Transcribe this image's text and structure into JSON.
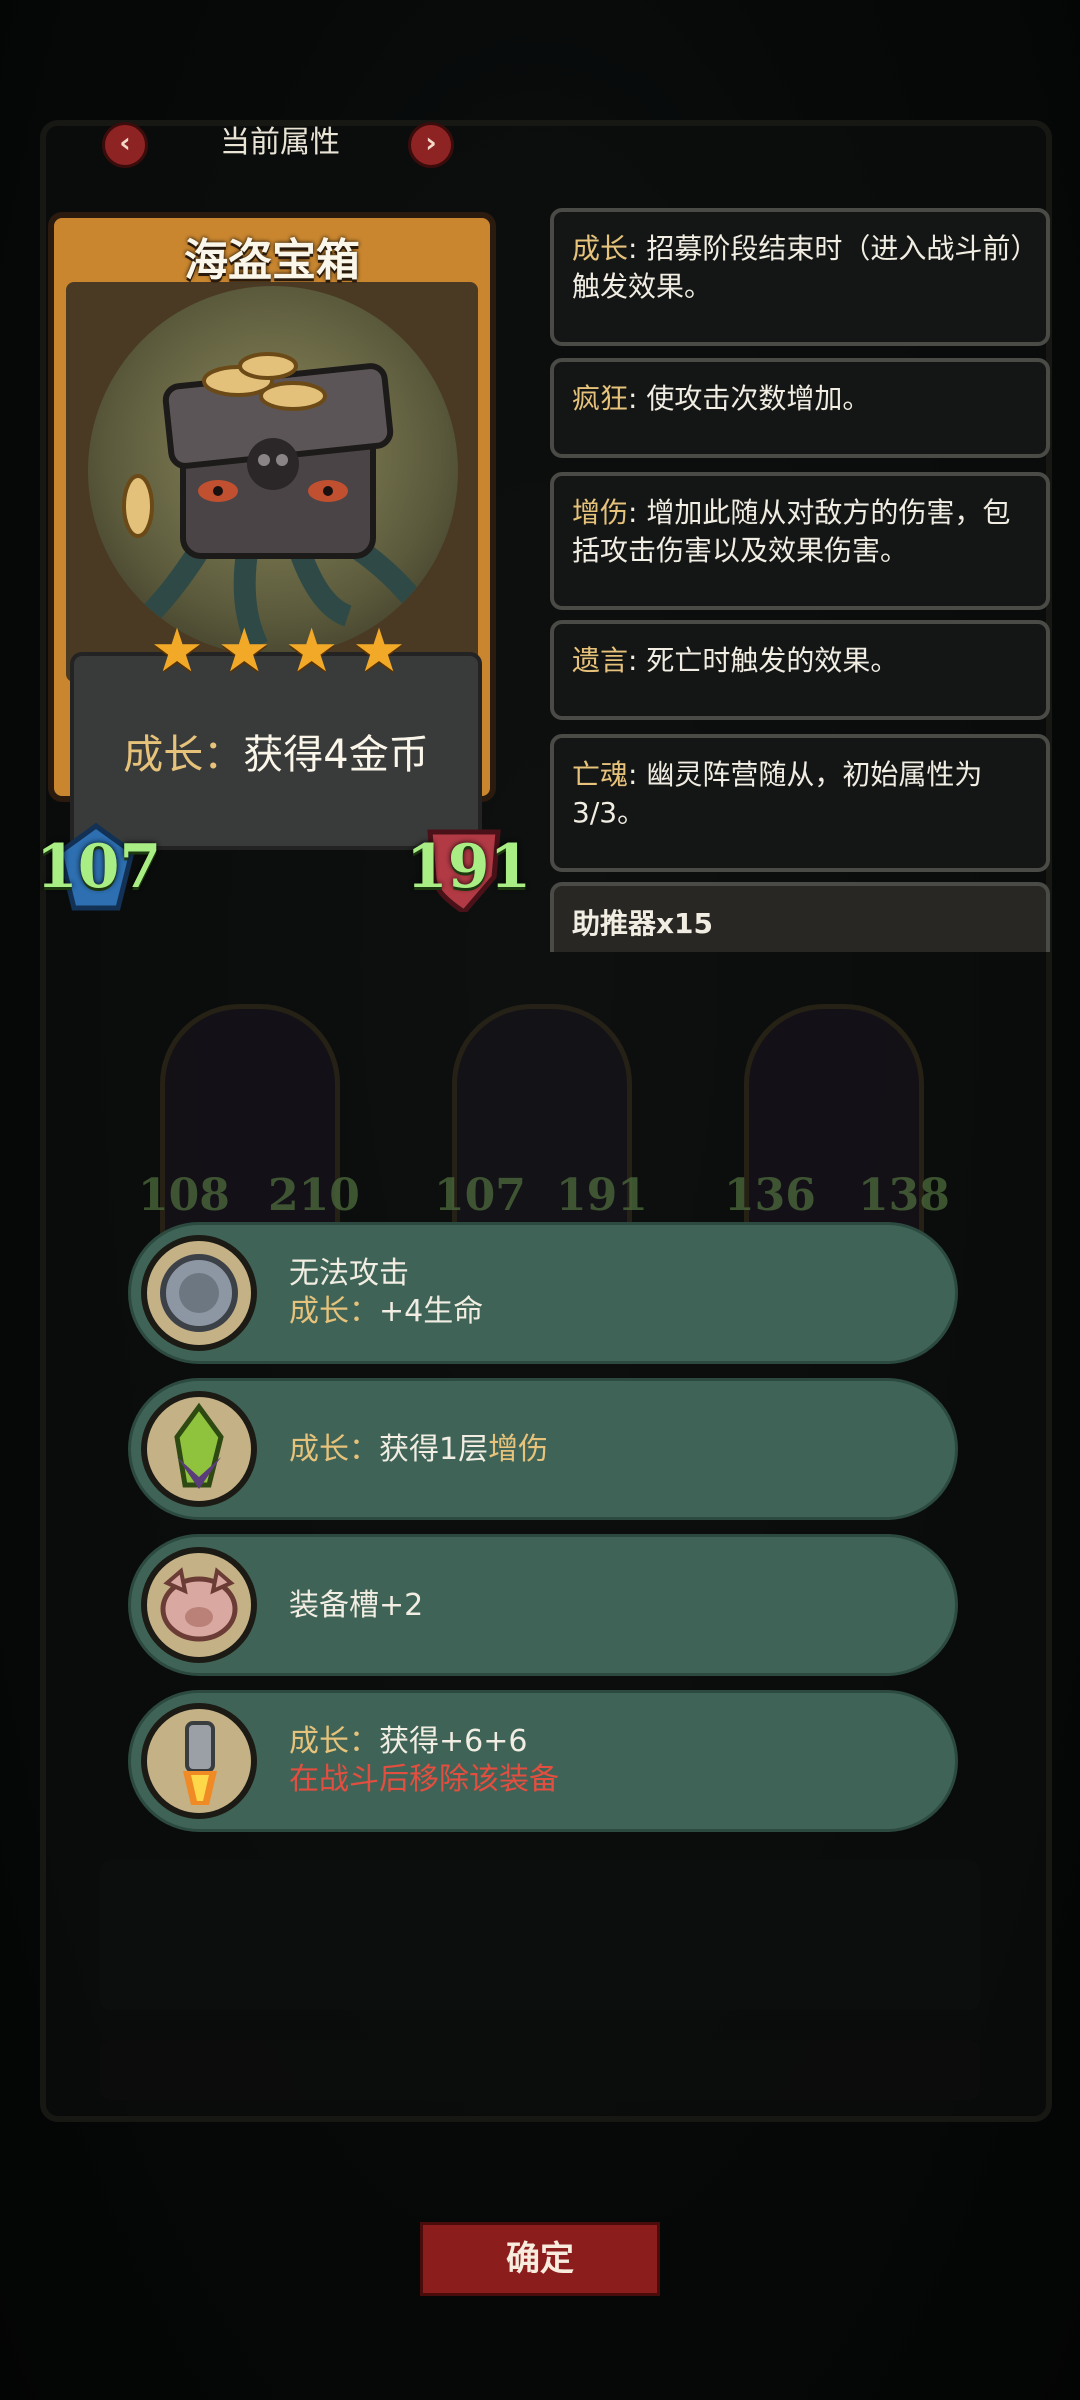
{
  "header": {
    "title": "当前属性",
    "prev_icon": "chevron-left-icon",
    "next_icon": "chevron-right-icon",
    "prev_symbol": "‹",
    "next_symbol": "›"
  },
  "card": {
    "name": "海盗宝箱",
    "stars": 4,
    "star_symbol": "★",
    "ability_keyword": "成长",
    "ability_sep": "：",
    "ability_text": "获得4金币",
    "attack": "107",
    "health": "191"
  },
  "keywords": [
    {
      "keyword": "成长",
      "text": ": 招募阶段结束时（进入战斗前）触发效果。"
    },
    {
      "keyword": "疯狂",
      "text": ": 使攻击次数增加。"
    },
    {
      "keyword": "增伤",
      "text": ": 增加此随从对敌方的伤害，包括攻击伤害以及效果伤害。"
    },
    {
      "keyword": "遗言",
      "text": ": 死亡时触发的效果。"
    },
    {
      "keyword": "亡魂",
      "text": ": 幽灵阵营随从，初始属性为3/3。"
    }
  ],
  "booster": "助推器x15",
  "board_minions": [
    {
      "attack": "108",
      "health": "210"
    },
    {
      "attack": "107",
      "health": "191"
    },
    {
      "attack": "136",
      "health": "138"
    }
  ],
  "equipment": [
    {
      "icon": "silver-coin-icon",
      "line1": "无法攻击",
      "keyword": "成长",
      "sep": "：",
      "line2": "+4生命"
    },
    {
      "icon": "green-crystal-icon",
      "keyword": "成长",
      "sep": "：",
      "line2a": "获得1层",
      "line2b": "增伤"
    },
    {
      "icon": "pig-icon",
      "line1": "装备槽+2"
    },
    {
      "icon": "rocket-booster-icon",
      "keyword": "成长",
      "sep": "：",
      "line1b": "获得+6+6",
      "warning": "在战斗后移除该装备"
    }
  ],
  "confirm_label": "确定",
  "colors": {
    "accent": "#e6c27a",
    "stat": "#a9ee84",
    "pill": "#3f6457",
    "warn": "#e24e3f",
    "button": "#8c1d1d"
  }
}
